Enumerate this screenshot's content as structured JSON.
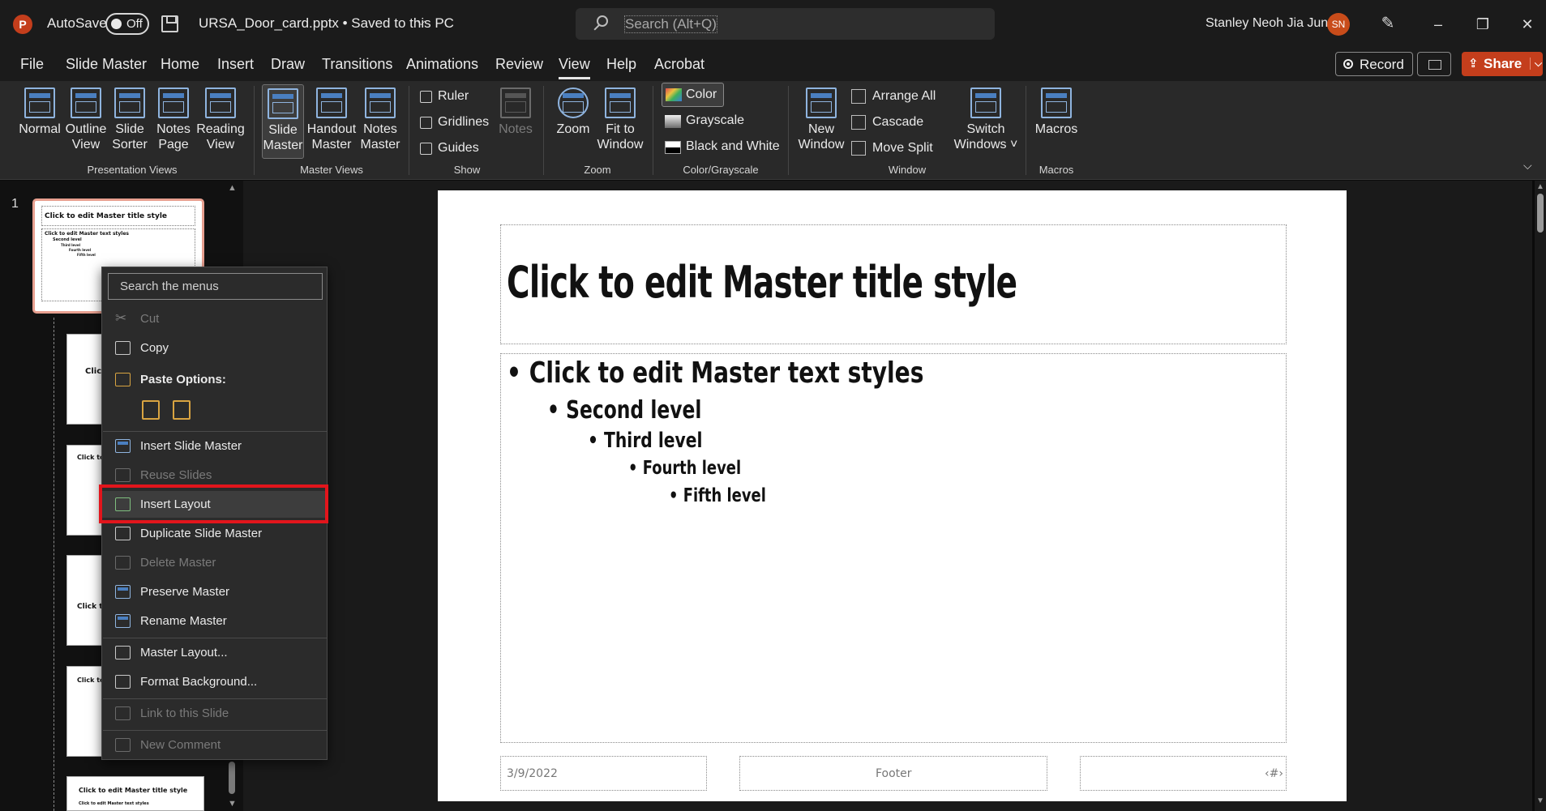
{
  "titlebar": {
    "app_logo": "P",
    "autosave_label": "AutoSave",
    "autosave_state": "Off",
    "document_title": "URSA_Door_card.pptx • Saved to this PC",
    "search_placeholder": "Search (Alt+Q)",
    "user_name": "Stanley Neoh Jia Jun",
    "user_initials": "SN",
    "window_controls": [
      "–",
      "❐",
      "✕"
    ]
  },
  "menu": {
    "tabs": [
      "File",
      "Slide Master",
      "Home",
      "Insert",
      "Draw",
      "Transitions",
      "Animations",
      "Review",
      "View",
      "Help",
      "Acrobat"
    ],
    "active_tab": "View",
    "record_label": "Record",
    "share_label": "Share"
  },
  "ribbon": {
    "presentation_views": {
      "label": "Presentation Views",
      "buttons": [
        {
          "line1": "Normal",
          "line2": ""
        },
        {
          "line1": "Outline",
          "line2": "View"
        },
        {
          "line1": "Slide",
          "line2": "Sorter"
        },
        {
          "line1": "Notes",
          "line2": "Page"
        },
        {
          "line1": "Reading",
          "line2": "View"
        }
      ]
    },
    "master_views": {
      "label": "Master Views",
      "buttons": [
        {
          "line1": "Slide",
          "line2": "Master"
        },
        {
          "line1": "Handout",
          "line2": "Master"
        },
        {
          "line1": "Notes",
          "line2": "Master"
        }
      ]
    },
    "show": {
      "label": "Show",
      "checkboxes": [
        "Ruler",
        "Gridlines",
        "Guides"
      ],
      "notes_label": "Notes"
    },
    "zoom": {
      "label": "Zoom",
      "zoom_label": "Zoom",
      "fit_line1": "Fit to",
      "fit_line2": "Window"
    },
    "color": {
      "label": "Color/Grayscale",
      "options": [
        "Color",
        "Grayscale",
        "Black and White"
      ]
    },
    "window": {
      "label": "Window",
      "new_line1": "New",
      "new_line2": "Window",
      "small_buttons": [
        "Arrange All",
        "Cascade",
        "Move Split"
      ],
      "switch_line1": "Switch",
      "switch_line2": "Windows ˅"
    },
    "macros": {
      "label": "Macros",
      "button": "Macros"
    }
  },
  "thumbnails": {
    "slide_number": "1",
    "master_title": "Click to edit Master title style",
    "master_body": [
      "Click to edit Master text styles",
      "Second level",
      "Third level",
      "Fourth level",
      "Fifth level"
    ],
    "layout_snippets": [
      "Click",
      "Click to edi",
      "Click to",
      "Click to ed",
      "Click to edit Master title style",
      "Click to edit Master text styles"
    ]
  },
  "slide": {
    "title": "Click to edit Master title style",
    "levels": [
      "• Click to edit Master text styles",
      "• Second level",
      "• Third level",
      "• Fourth level",
      "• Fifth level"
    ],
    "date": "3/9/2022",
    "footer": "Footer",
    "slide_number_glyph": "‹#›"
  },
  "context_menu": {
    "search_placeholder": "Search the menus",
    "cut": "Cut",
    "copy": "Copy",
    "paste_options": "Paste Options:",
    "insert_slide_master": "Insert Slide Master",
    "reuse_slides": "Reuse Slides",
    "insert_layout": "Insert Layout",
    "duplicate_slide_master": "Duplicate Slide Master",
    "delete_master": "Delete Master",
    "preserve_master": "Preserve Master",
    "rename_master": "Rename Master",
    "master_layout": "Master Layout...",
    "format_background": "Format Background...",
    "link_to_slide": "Link to this Slide",
    "new_comment": "New Comment"
  },
  "colors": {
    "accent_brand": "#c43e1c",
    "highlight_border": "#e2151c",
    "background": "#0b0b0b"
  }
}
